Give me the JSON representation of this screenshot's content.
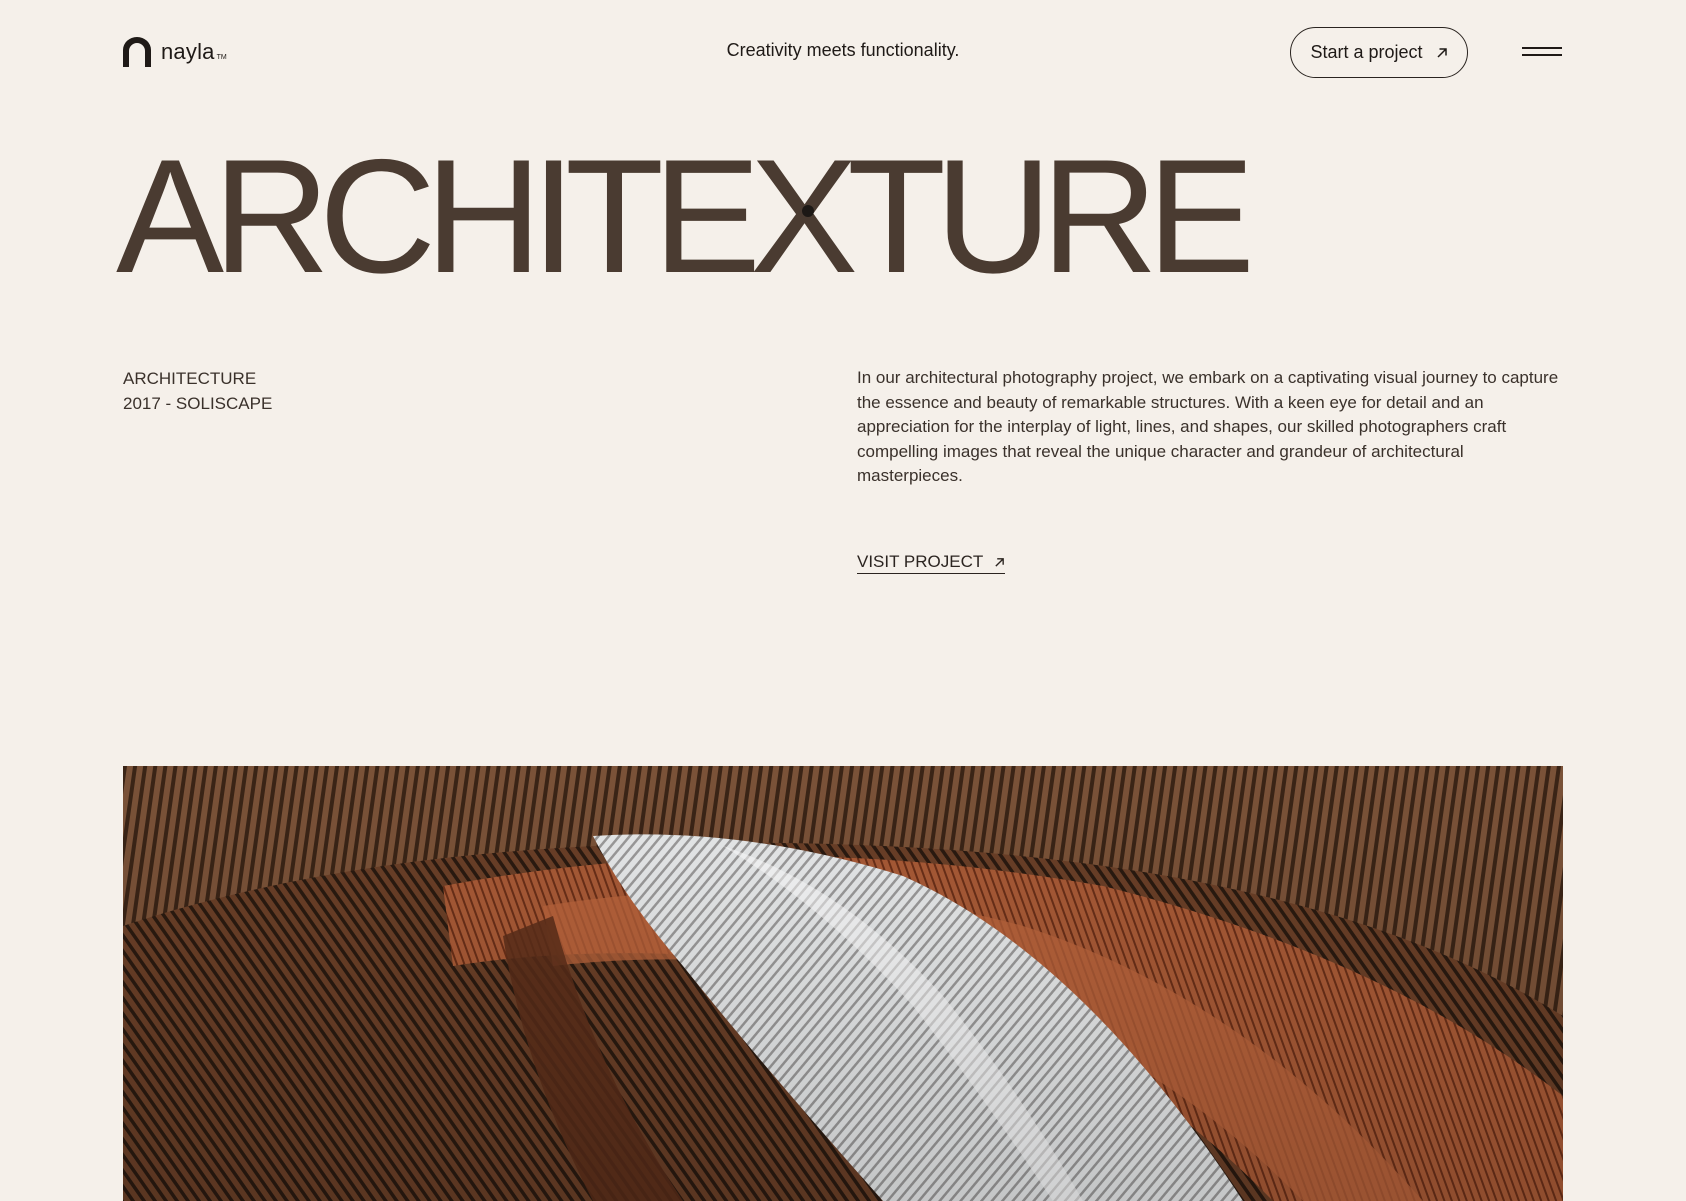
{
  "brand": {
    "name": "nayla",
    "tm": "TM"
  },
  "header": {
    "tagline": "Creativity meets functionality.",
    "cta_label": "Start a project",
    "cta_icon": "arrow-up-right-icon",
    "menu_icon": "hamburger-menu-icon"
  },
  "hero": {
    "title": "ARCHITEXTURE"
  },
  "project": {
    "category": "ARCHITECTURE",
    "year_name": "2017 - SOLISCAPE",
    "description": "In our architectural photography project, we embark on a captivating visual journey to capture the essence and beauty of remarkable structures. With a keen eye for detail and an appreciation for the interplay of light, lines, and shapes, our skilled photographers craft compelling images that reveal the unique character and grandeur of architectural masterpieces.",
    "visit_label": "VISIT PROJECT",
    "visit_icon": "arrow-up-right-icon"
  },
  "image": {
    "subject": "wooden-slat-ceiling-photo"
  },
  "colors": {
    "background": "#f5f0ea",
    "title": "#4a3b31",
    "text": "#3a312b",
    "dark": "#1f1a17"
  }
}
